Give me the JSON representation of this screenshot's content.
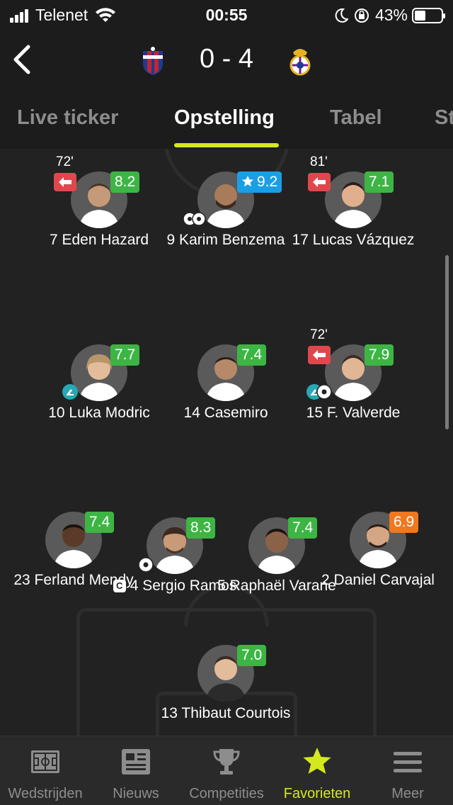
{
  "status_bar": {
    "carrier": "Telenet",
    "time": "00:55",
    "battery": "43%",
    "battery_level": 0.43
  },
  "header": {
    "home_crest": "eibar-crest",
    "away_crest": "real-madrid-crest",
    "score": "0 - 4"
  },
  "tabs": [
    {
      "label": "Live ticker"
    },
    {
      "label": "Opstelling"
    },
    {
      "label": "Tabel"
    },
    {
      "label": "St"
    }
  ],
  "players": [
    {
      "name": "7 Eden Hazard",
      "rating": "8.2",
      "rating_color": "#3db544",
      "sub_time": "72'"
    },
    {
      "name": "9 Karim Benzema",
      "rating": "9.2",
      "rating_color": "#1a9fe6",
      "star": true,
      "goals": 2
    },
    {
      "name": "17 Lucas Vázquez",
      "rating": "7.1",
      "rating_color": "#3db544",
      "sub_time": "81'"
    },
    {
      "name": "10 Luka Modric",
      "rating": "7.7",
      "rating_color": "#3db544",
      "assist": true
    },
    {
      "name": "14 Casemiro",
      "rating": "7.4",
      "rating_color": "#3db544"
    },
    {
      "name": "15 F. Valverde",
      "rating": "7.9",
      "rating_color": "#3db544",
      "sub_time": "72'",
      "assist": true,
      "goals": 1
    },
    {
      "name": "23 Ferland Mendy",
      "rating": "7.4",
      "rating_color": "#3db544"
    },
    {
      "name": "4 Sergio Ramos",
      "rating": "8.3",
      "rating_color": "#3db544",
      "captain": "C",
      "goals": 1
    },
    {
      "name": "5 Raphaël Varane",
      "rating": "7.4",
      "rating_color": "#3db544"
    },
    {
      "name": "2 Daniel Carvajal",
      "rating": "6.9",
      "rating_color": "#f0781e"
    },
    {
      "name": "13 Thibaut Courtois",
      "rating": "7.0",
      "rating_color": "#3db544"
    }
  ],
  "bottom_nav": [
    {
      "label": "Wedstrijden",
      "icon": "pitch-icon"
    },
    {
      "label": "Nieuws",
      "icon": "newspaper-icon"
    },
    {
      "label": "Competities",
      "icon": "trophy-icon"
    },
    {
      "label": "Favorieten",
      "icon": "star-icon",
      "active": true
    },
    {
      "label": "Meer",
      "icon": "menu-icon"
    }
  ],
  "colors": {
    "accent": "#d4e81e",
    "background": "#222222",
    "rating_green": "#3db544",
    "rating_orange": "#f0781e",
    "rating_blue": "#1a9fe6",
    "sub_red": "#e0474c"
  }
}
